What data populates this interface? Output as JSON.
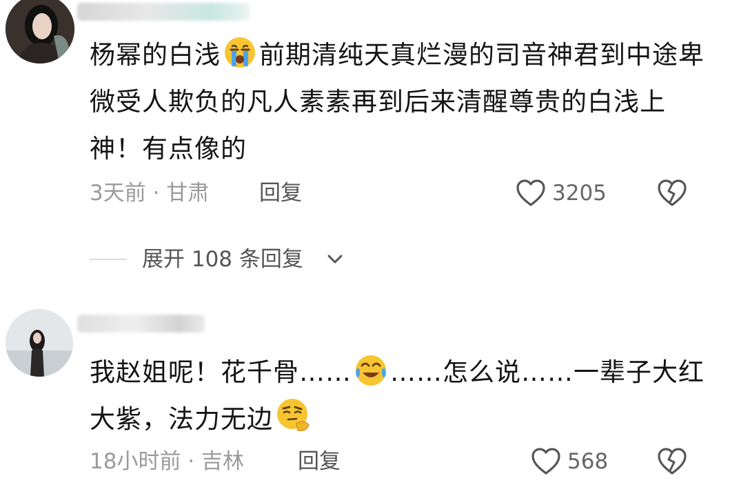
{
  "comments": [
    {
      "text_before_emoji": "杨幂的白浅",
      "emoji": "crying-face-emoji",
      "text_after_emoji": "前期清纯天真烂漫的司音神君到中途卑微受人欺负的凡人素素再到后来清醒尊贵的白浅上神！有点像的",
      "time_location": "3天前 · 甘肃",
      "reply_label": "回复",
      "like_count": "3205",
      "expand_replies": "展开 108 条回复"
    },
    {
      "text_before_emoji": "我赵姐呢！花千骨……",
      "emoji": "tearful-laughing-face-emoji",
      "text_after_emoji": "……怎么说……一辈子大红大紫，法力无边",
      "end_emoji": "thinking-face-emoji",
      "time_location": "18小时前 · 吉林",
      "reply_label": "回复",
      "like_count": "568"
    }
  ],
  "icons": {
    "like": "heart-outline-icon",
    "dislike": "broken-heart-icon",
    "expand": "chevron-down-icon"
  },
  "colors": {
    "text": "#141414",
    "meta": "#9a9a9a",
    "reply": "#555555",
    "icon": "#555555"
  }
}
